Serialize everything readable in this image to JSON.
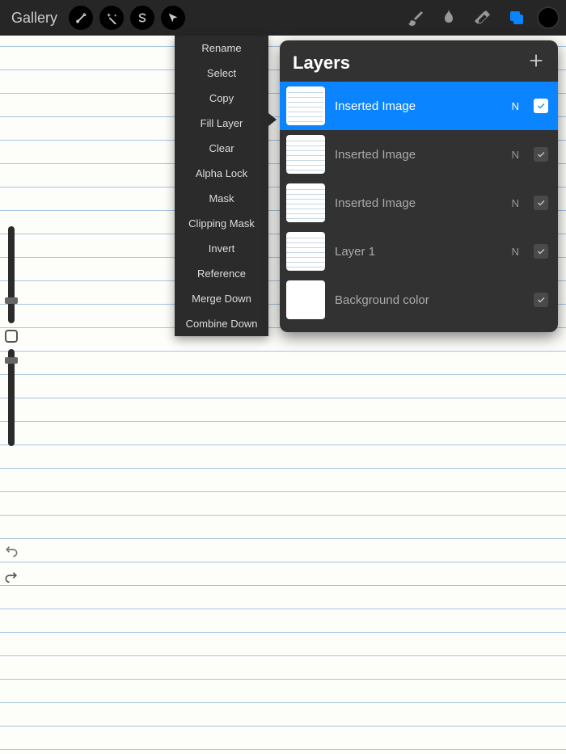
{
  "topbar": {
    "gallery_label": "Gallery"
  },
  "context_menu": {
    "items": [
      "Rename",
      "Select",
      "Copy",
      "Fill Layer",
      "Clear",
      "Alpha Lock",
      "Mask",
      "Clipping Mask",
      "Invert",
      "Reference",
      "Merge Down",
      "Combine Down"
    ]
  },
  "layers_panel": {
    "title": "Layers",
    "layers": [
      {
        "name": "Inserted Image",
        "blend": "N",
        "selected": true,
        "visible": true,
        "isBackground": false
      },
      {
        "name": "Inserted Image",
        "blend": "N",
        "selected": false,
        "visible": true,
        "isBackground": false
      },
      {
        "name": "Inserted Image",
        "blend": "N",
        "selected": false,
        "visible": true,
        "isBackground": false
      },
      {
        "name": "Layer 1",
        "blend": "N",
        "selected": false,
        "visible": true,
        "isBackground": false
      },
      {
        "name": "Background color",
        "blend": "",
        "selected": false,
        "visible": true,
        "isBackground": true
      }
    ]
  }
}
